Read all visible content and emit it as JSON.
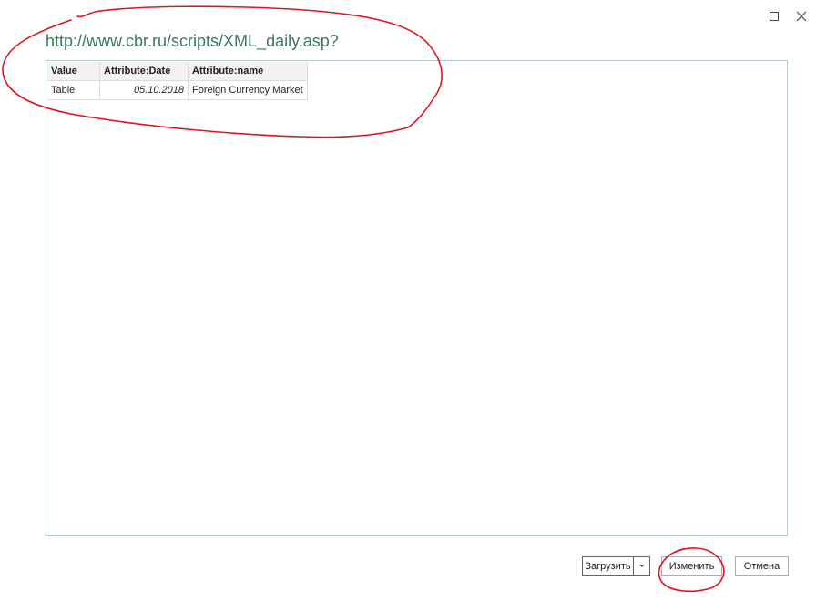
{
  "window": {
    "maximize_icon": "maximize-icon",
    "close_icon": "close-icon"
  },
  "header": {
    "url": "http://www.cbr.ru/scripts/XML_daily.asp?"
  },
  "preview_table": {
    "columns": [
      "Value",
      "Attribute:Date",
      "Attribute:name"
    ],
    "rows": [
      [
        "Table",
        "05.10.2018",
        "Foreign Currency Market"
      ]
    ]
  },
  "footer": {
    "load_label": "Загрузить",
    "load_dropdown_icon": "chevron-down-icon",
    "edit_label": "Изменить",
    "cancel_label": "Отмена"
  },
  "annotation_color": "#e0141e",
  "accent_color": "#3c7a5a"
}
